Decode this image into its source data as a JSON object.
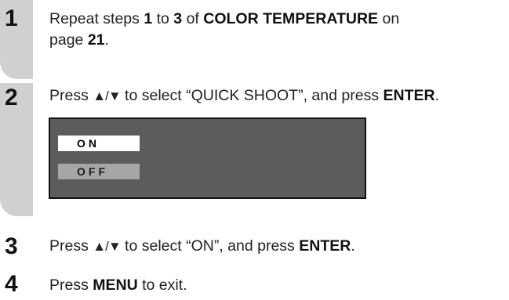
{
  "steps": [
    {
      "number": "1",
      "text": {
        "t1": "Repeat steps ",
        "b1": "1",
        "t2": " to ",
        "b2": "3",
        "t3": " of ",
        "b3": "COLOR TEMPERATURE",
        "t4": " on",
        "t5": "page ",
        "b4": "21",
        "t6": "."
      }
    },
    {
      "number": "2",
      "text": {
        "t1": "Press ",
        "arrows": "▲/▼",
        "t2": " to select “QUICK SHOOT”, and press ",
        "b1": "ENTER",
        "t3": "."
      }
    },
    {
      "number": "3",
      "text": {
        "t1": "Press ",
        "arrows": "▲/▼",
        "t2": " to select “ON”, and press ",
        "b1": "ENTER",
        "t3": "."
      }
    },
    {
      "number": "4",
      "text": {
        "t1": "Press ",
        "b1": "MENU",
        "t2": " to exit."
      }
    }
  ],
  "osd_menu": {
    "options": [
      {
        "label": "ON",
        "state": "selected"
      },
      {
        "label": "OFF",
        "state": "unselected"
      }
    ]
  },
  "colors": {
    "step_band": "#d0d0d0",
    "osd_background": "#5c5c5c",
    "osd_selected": "#ffffff",
    "osd_unselected": "#a6a6a6"
  }
}
